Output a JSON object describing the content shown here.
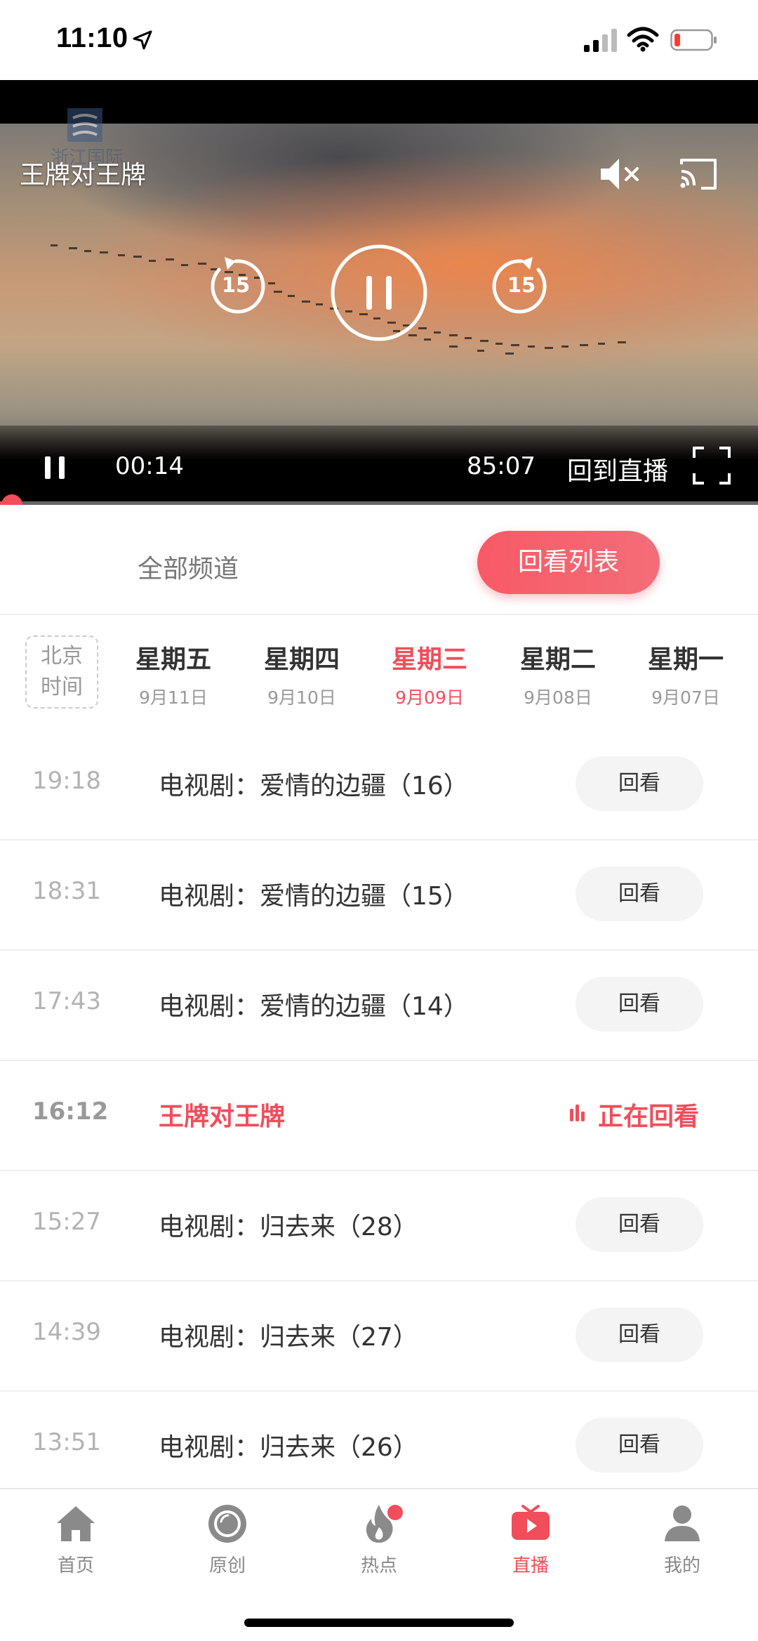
{
  "status_bar": {
    "time": "11:10",
    "icons": [
      "location-arrow-icon",
      "signal-icon",
      "wifi-icon",
      "battery-low-icon"
    ],
    "battery_color": "#ff3b30"
  },
  "player": {
    "title": "王牌对王牌",
    "watermark_text": "浙江国际",
    "skip_back_seconds": "15",
    "skip_forward_seconds": "15",
    "current_time": "00:14",
    "total_time": "85:07",
    "back_to_live_label": "回到直播",
    "progress_fraction": 0.003,
    "icons": [
      "mute-icon",
      "cast-icon",
      "rewind-15-icon",
      "pause-icon",
      "forward-15-icon",
      "fullscreen-icon"
    ]
  },
  "tabs": {
    "all_channels": "全部频道",
    "replay_list": "回看列表",
    "active": "replay_list"
  },
  "dates": {
    "timezone_label_line1": "北京",
    "timezone_label_line2": "时间",
    "days": [
      {
        "name": "星期五",
        "date": "9月11日"
      },
      {
        "name": "星期四",
        "date": "9月10日"
      },
      {
        "name": "星期三",
        "date": "9月09日"
      },
      {
        "name": "星期二",
        "date": "9月08日"
      },
      {
        "name": "星期一",
        "date": "9月07日"
      }
    ],
    "active_index": 2
  },
  "programs": [
    {
      "time": "19:18",
      "title": "电视剧：爱情的边疆（16）",
      "action": "回看"
    },
    {
      "time": "18:31",
      "title": "电视剧：爱情的边疆（15）",
      "action": "回看"
    },
    {
      "time": "17:43",
      "title": "电视剧：爱情的边疆（14）",
      "action": "回看"
    },
    {
      "time": "16:12",
      "title": "王牌对王牌",
      "action": "正在回看",
      "current": true
    },
    {
      "time": "15:27",
      "title": "电视剧：归去来（28）",
      "action": "回看"
    },
    {
      "time": "14:39",
      "title": "电视剧：归去来（27）",
      "action": "回看"
    },
    {
      "time": "13:51",
      "title": "电视剧：归去来（26）",
      "action": "回看"
    }
  ],
  "tabbar": {
    "items": [
      {
        "label": "首页",
        "icon": "home-icon"
      },
      {
        "label": "原创",
        "icon": "original-icon"
      },
      {
        "label": "热点",
        "icon": "flame-icon",
        "badge": true
      },
      {
        "label": "直播",
        "icon": "live-tv-icon",
        "active": true
      },
      {
        "label": "我的",
        "icon": "profile-icon"
      }
    ]
  },
  "colors": {
    "accent": "#f24d5b",
    "muted_text": "#999999"
  }
}
